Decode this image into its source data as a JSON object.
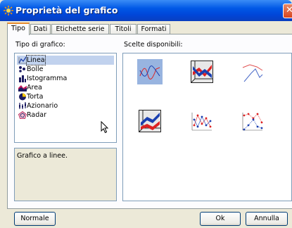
{
  "window": {
    "title": "Proprietà del grafico",
    "close_glyph": "✕"
  },
  "tabs": [
    {
      "label": "Tipo",
      "active": true
    },
    {
      "label": "Dati"
    },
    {
      "label": "Etichette serie"
    },
    {
      "label": "Titoli"
    },
    {
      "label": "Formati"
    }
  ],
  "chart_type": {
    "label": "Tipo di grafico:",
    "items": [
      {
        "label": "Linea",
        "icon": "line-chart-icon",
        "selected": true
      },
      {
        "label": "Bolle",
        "icon": "bubble-chart-icon"
      },
      {
        "label": "Istogramma",
        "icon": "bar-chart-icon"
      },
      {
        "label": "Area",
        "icon": "area-chart-icon"
      },
      {
        "label": "Torta",
        "icon": "pie-chart-icon"
      },
      {
        "label": "Azionario",
        "icon": "stock-chart-icon"
      },
      {
        "label": "Radar",
        "icon": "radar-chart-icon"
      }
    ],
    "description": "Grafico a linee."
  },
  "options": {
    "label": "Scelte disponibili:",
    "items": [
      {
        "icon": "line-basic-icon",
        "selected": true
      },
      {
        "icon": "line-3d-ribbon-icon"
      },
      {
        "icon": "line-thin-icon"
      },
      {
        "icon": "line-3d-stacked-icon"
      },
      {
        "icon": "line-markers-icon"
      },
      {
        "icon": "line-markers-alt-icon"
      }
    ]
  },
  "buttons": {
    "normal": "Normale",
    "ok": "Ok",
    "cancel": "Annulla"
  },
  "colors": {
    "titlebar": "#0058e6",
    "selection": "#98b4e0",
    "tab_highlight": "#e68b2c"
  }
}
